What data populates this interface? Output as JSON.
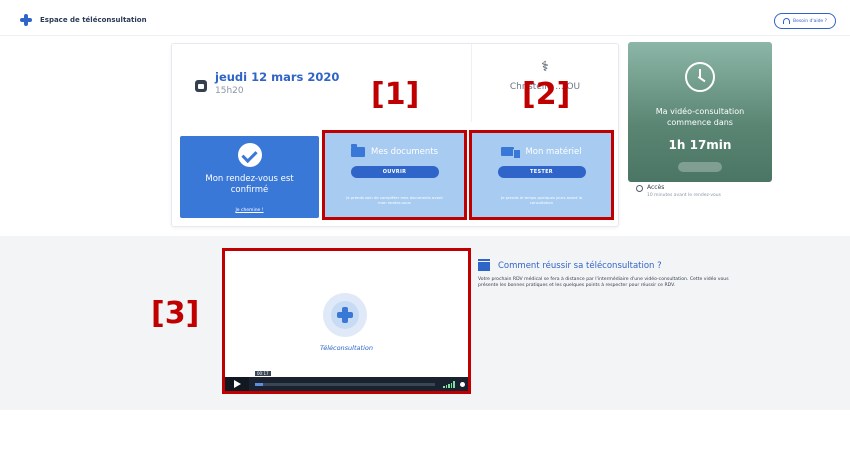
{
  "header": {
    "brand_label": "Espace de téléconsultation",
    "help_label": "Besoin d'aide ?"
  },
  "appointment": {
    "date": "jeudi 12 mars 2020",
    "time": "15h20",
    "doctor_name": "Christelle ...IOU",
    "doctor_sub": "..."
  },
  "confirmation": {
    "text": "Mon rendez-vous est confirmé",
    "link": "Je chemine !"
  },
  "documents": {
    "title": "Mes documents",
    "button": "OUVRIR",
    "desc": "Je prends soin de compléter mes documents avant mon rendez-vous"
  },
  "materiel": {
    "title": "Mon matériel",
    "button": "TESTER",
    "desc": "Je prends le temps quelques jours avant la consultation"
  },
  "countdown": {
    "label": "Ma vidéo-consultation commence dans",
    "value": "1h 17min"
  },
  "access": {
    "title": "Accès",
    "subtitle": "10 minutes avant le rendez-vous"
  },
  "video": {
    "caption": "Téléconsultation",
    "timestamp": "00:17"
  },
  "how_to": {
    "title": "Comment réussir sa téléconsultation ?",
    "text": "Votre prochain RDV médical se fera à distance par l'intermédiaire d'une vidéo-consultation. Cette vidéo vous présente les bonnes pratiques et les quelques points à respecter pour réussir ce RDV."
  },
  "annotations": {
    "marker1": "[1]",
    "marker2": "[2]",
    "marker3": "[3]"
  },
  "colors": {
    "primary": "#2f64c8",
    "confirm_bg": "#3a78d8",
    "action_bg": "#a8cbf2",
    "annotation_red": "#c00000",
    "countdown_green": "#5a8573"
  }
}
